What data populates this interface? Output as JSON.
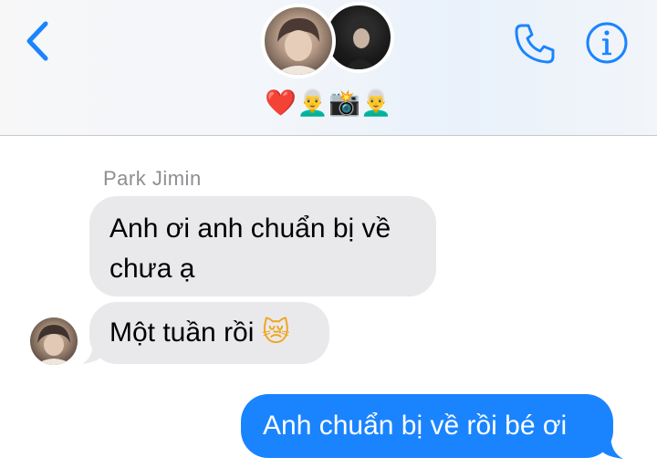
{
  "header": {
    "group_name": "❤️👨‍🦳📸👨‍🦳",
    "back_icon": "chevron-left-icon",
    "call_icon": "phone-icon",
    "info_icon": "info-icon",
    "accent_color": "#1a84ff"
  },
  "conversation": {
    "sender_name": "Park Jimin",
    "messages": [
      {
        "direction": "incoming",
        "text": "Anh ơi anh chuẩn bị về chưa ạ"
      },
      {
        "direction": "incoming",
        "text": "Một tuần rồi",
        "emoji": "😿"
      },
      {
        "direction": "outgoing",
        "text": "Anh chuẩn bị về rồi bé ơi"
      }
    ]
  },
  "colors": {
    "incoming_bubble": "#e9e9eb",
    "outgoing_bubble": "#1a84ff",
    "sender_name": "#8e8e93"
  }
}
